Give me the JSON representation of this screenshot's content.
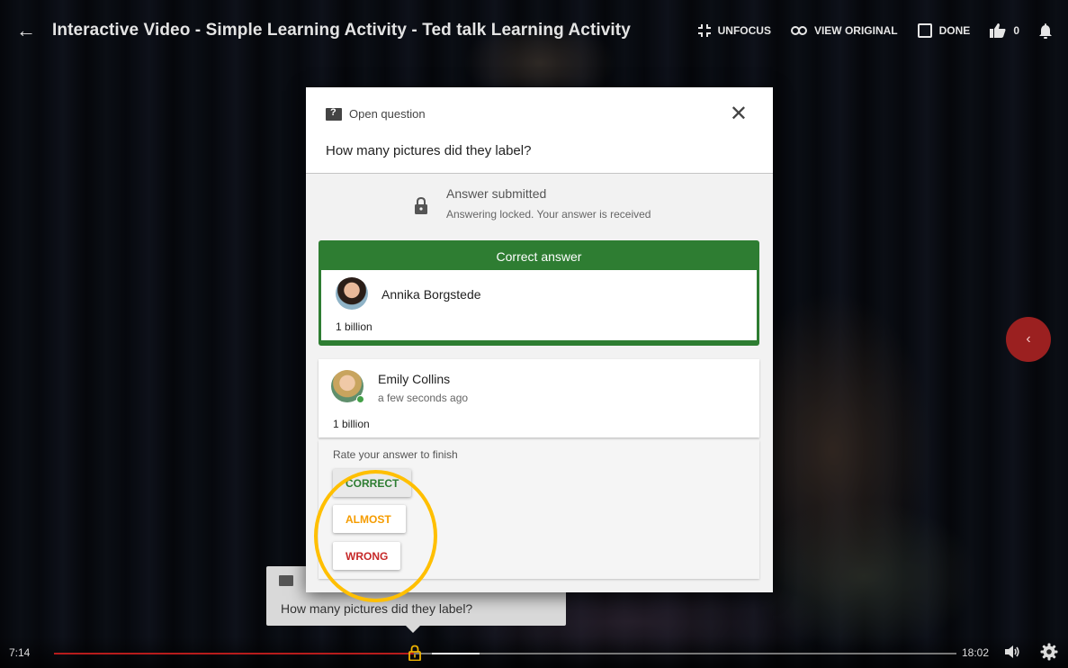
{
  "header": {
    "back_icon": "arrow-left-icon",
    "title": "Interactive Video - Simple Learning Activity - Ted talk Learning Activity",
    "unfocus_label": "UNFOCUS",
    "view_original_label": "VIEW ORIGINAL",
    "done_label": "DONE",
    "likes_count": "0"
  },
  "modal": {
    "type_label": "Open question",
    "question": "How many pictures did they label?",
    "status_title": "Answer submitted",
    "status_subtitle": "Answering locked. Your answer is received",
    "correct_header": "Correct answer",
    "correct_author": "Annika Borgstede",
    "correct_answer": "1 billion",
    "my_author": "Emily Collins",
    "my_time": "a few seconds ago",
    "my_answer": "1 billion",
    "rate_label": "Rate your answer to finish",
    "rate_buttons": {
      "correct": "CORRECT",
      "almost": "ALMOST",
      "wrong": "WRONG"
    }
  },
  "background_card": {
    "question": "How many pictures did they label?"
  },
  "player": {
    "current_time": "7:14",
    "total_time": "18:02",
    "progress_fraction": 0.3987
  },
  "colors": {
    "accent_green": "#2e7d32",
    "almost_orange": "#f59c00",
    "wrong_red": "#c62828",
    "progress_red": "#b71c1c",
    "highlight_yellow": "#ffbf00"
  }
}
